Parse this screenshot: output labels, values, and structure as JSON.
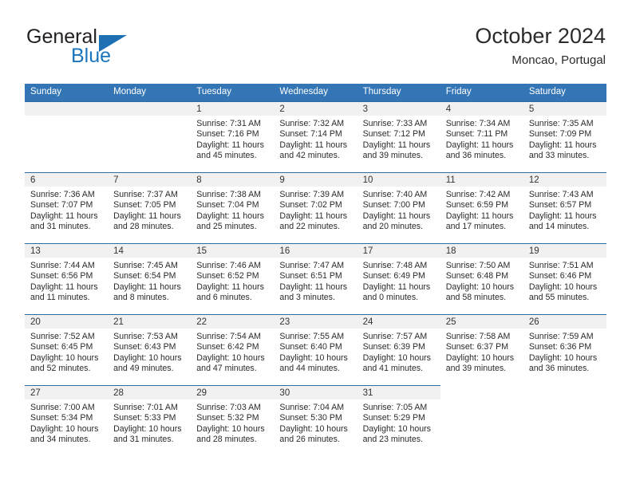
{
  "logo": {
    "word_top": "General",
    "word_bottom": "Blue",
    "triangle_color": "#1f6fb5",
    "text_color": "#231f20",
    "blue_color": "#1b75bc"
  },
  "header": {
    "title": "October 2024",
    "subtitle": "Moncao, Portugal"
  },
  "theme": {
    "header_row_bg": "#3476b5",
    "row_separator": "#2e6da4",
    "daynum_bar_bg": "#f1f1f1",
    "text": "#2a2a2a"
  },
  "weekdays": [
    "Sunday",
    "Monday",
    "Tuesday",
    "Wednesday",
    "Thursday",
    "Friday",
    "Saturday"
  ],
  "weeks": [
    [
      {
        "day": "",
        "sunrise": "",
        "sunset": "",
        "daylight1": "",
        "daylight2": ""
      },
      {
        "day": "",
        "sunrise": "",
        "sunset": "",
        "daylight1": "",
        "daylight2": ""
      },
      {
        "day": "1",
        "sunrise": "Sunrise: 7:31 AM",
        "sunset": "Sunset: 7:16 PM",
        "daylight1": "Daylight: 11 hours",
        "daylight2": "and 45 minutes."
      },
      {
        "day": "2",
        "sunrise": "Sunrise: 7:32 AM",
        "sunset": "Sunset: 7:14 PM",
        "daylight1": "Daylight: 11 hours",
        "daylight2": "and 42 minutes."
      },
      {
        "day": "3",
        "sunrise": "Sunrise: 7:33 AM",
        "sunset": "Sunset: 7:12 PM",
        "daylight1": "Daylight: 11 hours",
        "daylight2": "and 39 minutes."
      },
      {
        "day": "4",
        "sunrise": "Sunrise: 7:34 AM",
        "sunset": "Sunset: 7:11 PM",
        "daylight1": "Daylight: 11 hours",
        "daylight2": "and 36 minutes."
      },
      {
        "day": "5",
        "sunrise": "Sunrise: 7:35 AM",
        "sunset": "Sunset: 7:09 PM",
        "daylight1": "Daylight: 11 hours",
        "daylight2": "and 33 minutes."
      }
    ],
    [
      {
        "day": "6",
        "sunrise": "Sunrise: 7:36 AM",
        "sunset": "Sunset: 7:07 PM",
        "daylight1": "Daylight: 11 hours",
        "daylight2": "and 31 minutes."
      },
      {
        "day": "7",
        "sunrise": "Sunrise: 7:37 AM",
        "sunset": "Sunset: 7:05 PM",
        "daylight1": "Daylight: 11 hours",
        "daylight2": "and 28 minutes."
      },
      {
        "day": "8",
        "sunrise": "Sunrise: 7:38 AM",
        "sunset": "Sunset: 7:04 PM",
        "daylight1": "Daylight: 11 hours",
        "daylight2": "and 25 minutes."
      },
      {
        "day": "9",
        "sunrise": "Sunrise: 7:39 AM",
        "sunset": "Sunset: 7:02 PM",
        "daylight1": "Daylight: 11 hours",
        "daylight2": "and 22 minutes."
      },
      {
        "day": "10",
        "sunrise": "Sunrise: 7:40 AM",
        "sunset": "Sunset: 7:00 PM",
        "daylight1": "Daylight: 11 hours",
        "daylight2": "and 20 minutes."
      },
      {
        "day": "11",
        "sunrise": "Sunrise: 7:42 AM",
        "sunset": "Sunset: 6:59 PM",
        "daylight1": "Daylight: 11 hours",
        "daylight2": "and 17 minutes."
      },
      {
        "day": "12",
        "sunrise": "Sunrise: 7:43 AM",
        "sunset": "Sunset: 6:57 PM",
        "daylight1": "Daylight: 11 hours",
        "daylight2": "and 14 minutes."
      }
    ],
    [
      {
        "day": "13",
        "sunrise": "Sunrise: 7:44 AM",
        "sunset": "Sunset: 6:56 PM",
        "daylight1": "Daylight: 11 hours",
        "daylight2": "and 11 minutes."
      },
      {
        "day": "14",
        "sunrise": "Sunrise: 7:45 AM",
        "sunset": "Sunset: 6:54 PM",
        "daylight1": "Daylight: 11 hours",
        "daylight2": "and 8 minutes."
      },
      {
        "day": "15",
        "sunrise": "Sunrise: 7:46 AM",
        "sunset": "Sunset: 6:52 PM",
        "daylight1": "Daylight: 11 hours",
        "daylight2": "and 6 minutes."
      },
      {
        "day": "16",
        "sunrise": "Sunrise: 7:47 AM",
        "sunset": "Sunset: 6:51 PM",
        "daylight1": "Daylight: 11 hours",
        "daylight2": "and 3 minutes."
      },
      {
        "day": "17",
        "sunrise": "Sunrise: 7:48 AM",
        "sunset": "Sunset: 6:49 PM",
        "daylight1": "Daylight: 11 hours",
        "daylight2": "and 0 minutes."
      },
      {
        "day": "18",
        "sunrise": "Sunrise: 7:50 AM",
        "sunset": "Sunset: 6:48 PM",
        "daylight1": "Daylight: 10 hours",
        "daylight2": "and 58 minutes."
      },
      {
        "day": "19",
        "sunrise": "Sunrise: 7:51 AM",
        "sunset": "Sunset: 6:46 PM",
        "daylight1": "Daylight: 10 hours",
        "daylight2": "and 55 minutes."
      }
    ],
    [
      {
        "day": "20",
        "sunrise": "Sunrise: 7:52 AM",
        "sunset": "Sunset: 6:45 PM",
        "daylight1": "Daylight: 10 hours",
        "daylight2": "and 52 minutes."
      },
      {
        "day": "21",
        "sunrise": "Sunrise: 7:53 AM",
        "sunset": "Sunset: 6:43 PM",
        "daylight1": "Daylight: 10 hours",
        "daylight2": "and 49 minutes."
      },
      {
        "day": "22",
        "sunrise": "Sunrise: 7:54 AM",
        "sunset": "Sunset: 6:42 PM",
        "daylight1": "Daylight: 10 hours",
        "daylight2": "and 47 minutes."
      },
      {
        "day": "23",
        "sunrise": "Sunrise: 7:55 AM",
        "sunset": "Sunset: 6:40 PM",
        "daylight1": "Daylight: 10 hours",
        "daylight2": "and 44 minutes."
      },
      {
        "day": "24",
        "sunrise": "Sunrise: 7:57 AM",
        "sunset": "Sunset: 6:39 PM",
        "daylight1": "Daylight: 10 hours",
        "daylight2": "and 41 minutes."
      },
      {
        "day": "25",
        "sunrise": "Sunrise: 7:58 AM",
        "sunset": "Sunset: 6:37 PM",
        "daylight1": "Daylight: 10 hours",
        "daylight2": "and 39 minutes."
      },
      {
        "day": "26",
        "sunrise": "Sunrise: 7:59 AM",
        "sunset": "Sunset: 6:36 PM",
        "daylight1": "Daylight: 10 hours",
        "daylight2": "and 36 minutes."
      }
    ],
    [
      {
        "day": "27",
        "sunrise": "Sunrise: 7:00 AM",
        "sunset": "Sunset: 5:34 PM",
        "daylight1": "Daylight: 10 hours",
        "daylight2": "and 34 minutes."
      },
      {
        "day": "28",
        "sunrise": "Sunrise: 7:01 AM",
        "sunset": "Sunset: 5:33 PM",
        "daylight1": "Daylight: 10 hours",
        "daylight2": "and 31 minutes."
      },
      {
        "day": "29",
        "sunrise": "Sunrise: 7:03 AM",
        "sunset": "Sunset: 5:32 PM",
        "daylight1": "Daylight: 10 hours",
        "daylight2": "and 28 minutes."
      },
      {
        "day": "30",
        "sunrise": "Sunrise: 7:04 AM",
        "sunset": "Sunset: 5:30 PM",
        "daylight1": "Daylight: 10 hours",
        "daylight2": "and 26 minutes."
      },
      {
        "day": "31",
        "sunrise": "Sunrise: 7:05 AM",
        "sunset": "Sunset: 5:29 PM",
        "daylight1": "Daylight: 10 hours",
        "daylight2": "and 23 minutes."
      },
      {
        "day": "",
        "sunrise": "",
        "sunset": "",
        "daylight1": "",
        "daylight2": ""
      },
      {
        "day": "",
        "sunrise": "",
        "sunset": "",
        "daylight1": "",
        "daylight2": ""
      }
    ]
  ]
}
